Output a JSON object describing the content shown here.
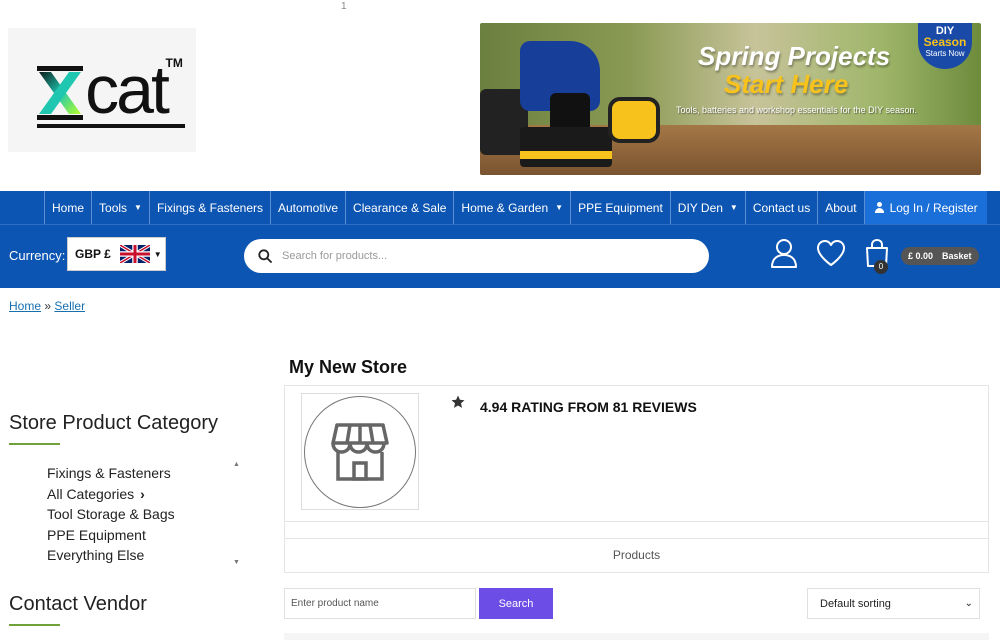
{
  "page_number": "1",
  "logo": {
    "text": "cat",
    "tm": "TM"
  },
  "banner": {
    "title_line1": "Spring Projects",
    "title_line2": "Start Here",
    "subtitle": "Tools, batteries and workshop essentials for the DIY season.",
    "badge_line1": "DIY",
    "badge_line2": "Season",
    "badge_line3": "Starts Now"
  },
  "nav": {
    "items": [
      {
        "label": "Home"
      },
      {
        "label": "Tools"
      },
      {
        "label": "Fixings & Fasteners"
      },
      {
        "label": "Automotive"
      },
      {
        "label": "Clearance & Sale"
      },
      {
        "label": "Home & Garden"
      },
      {
        "label": "PPE Equipment"
      },
      {
        "label": "DIY Den"
      },
      {
        "label": "Contact us"
      },
      {
        "label": "About"
      },
      {
        "label": "Log In / Register"
      }
    ]
  },
  "utility": {
    "currency_label": "Currency:",
    "currency_value": "GBP £",
    "search_placeholder": "Search for products...",
    "basket_count": "0",
    "basket_total": "£ 0.00",
    "basket_label": "Basket"
  },
  "breadcrumb": {
    "home": "Home",
    "separator": "»",
    "current": "Seller"
  },
  "sidebar": {
    "category_title": "Store Product Category",
    "categories": [
      {
        "label": "Fixings & Fasteners"
      },
      {
        "label": "All Categories"
      },
      {
        "label": "Tool Storage & Bags"
      },
      {
        "label": "PPE Equipment"
      },
      {
        "label": "Everything Else"
      }
    ],
    "contact_title": "Contact Vendor"
  },
  "store": {
    "name": "My New Store",
    "rating_text": "4.94 RATING FROM 81 REVIEWS",
    "tab_products": "Products"
  },
  "product_search": {
    "placeholder": "Enter product name",
    "button_label": "Search",
    "sort_value": "Default sorting"
  },
  "colors": {
    "nav_blue": "#0d55b3",
    "search_button": "#6c4ee6",
    "accent_green": "#6fa23a",
    "logo_teal": "#1fc7b0"
  }
}
